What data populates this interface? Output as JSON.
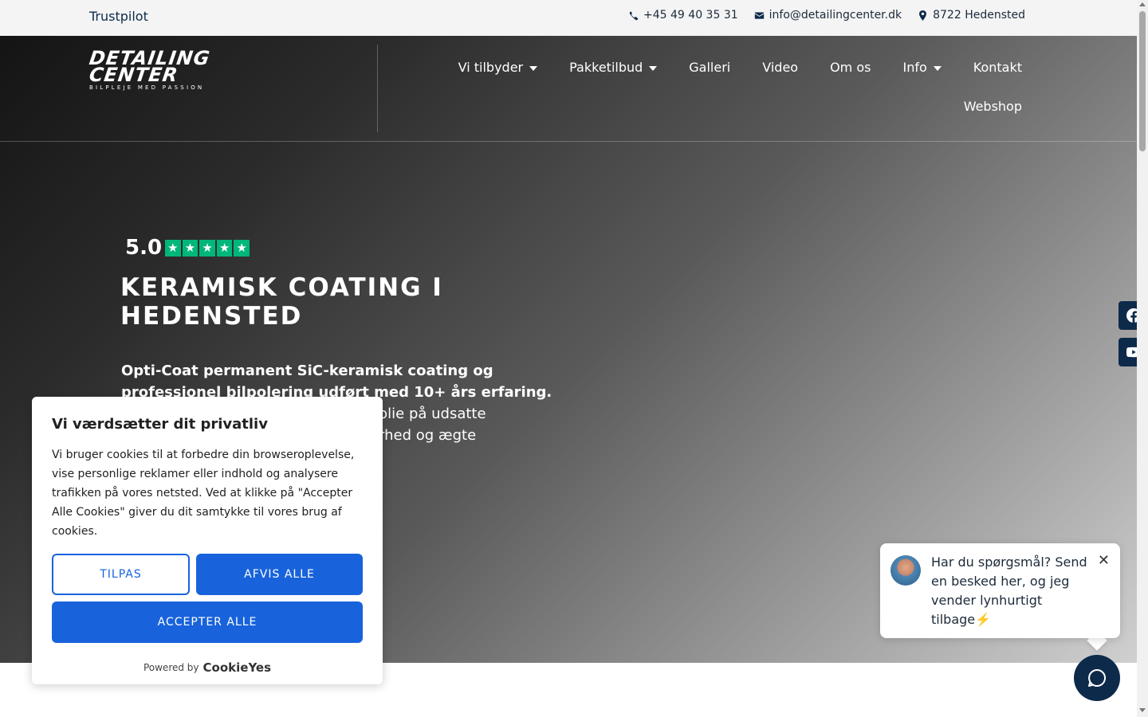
{
  "topbar": {
    "trustpilot": "Trustpilot",
    "phone": "+45 49 40 35 31",
    "email": "info@detailingcenter.dk",
    "location": "8722 Hedensted"
  },
  "logo": {
    "line1": "DETAILING",
    "line2": "CENTER",
    "tagline": "BILPLEJE MED PASSION"
  },
  "nav": {
    "items": [
      {
        "label": "Vi tilbyder",
        "dropdown": true
      },
      {
        "label": "Pakketilbud",
        "dropdown": true
      },
      {
        "label": "Galleri",
        "dropdown": false
      },
      {
        "label": "Video",
        "dropdown": false
      },
      {
        "label": "Om os",
        "dropdown": false
      },
      {
        "label": "Info",
        "dropdown": true
      },
      {
        "label": "Kontakt",
        "dropdown": false
      }
    ],
    "second_row": "Webshop"
  },
  "hero": {
    "rating": "5.0",
    "stars": 5,
    "title": "KERAMISK COATING I HEDENSTED",
    "text_bold": "Opti-Coat permanent SiC-keramisk coating og professionel bilpolering udført med 10+ års erfaring.",
    "text_line3": "gsfolie på udsatte",
    "text_line4": "arhed og ægte"
  },
  "social": [
    "facebook-icon",
    "youtube-icon"
  ],
  "cookie": {
    "title": "Vi værdsætter dit privatliv",
    "body": "Vi bruger cookies til at forbedre din browseroplevelse, vise personlige reklamer eller indhold og analysere trafikken på vores netsted. Ved at klikke på \"Accepter Alle Cookies\" giver du dit samtykke til vores brug af cookies.",
    "customize": "TILPAS",
    "reject": "AFVIS ALLE",
    "accept": "ACCEPTER ALLE",
    "powered_by": "Powered by",
    "brand": "CookieYes"
  },
  "chat": {
    "message": "Har du spørgsmål? Send en besked her, og jeg vender lynhurtigt tilbage⚡️"
  },
  "colors": {
    "navy": "#0d2a4a",
    "cookie_blue": "#1863dc",
    "trustpilot_green": "#00b67a"
  }
}
